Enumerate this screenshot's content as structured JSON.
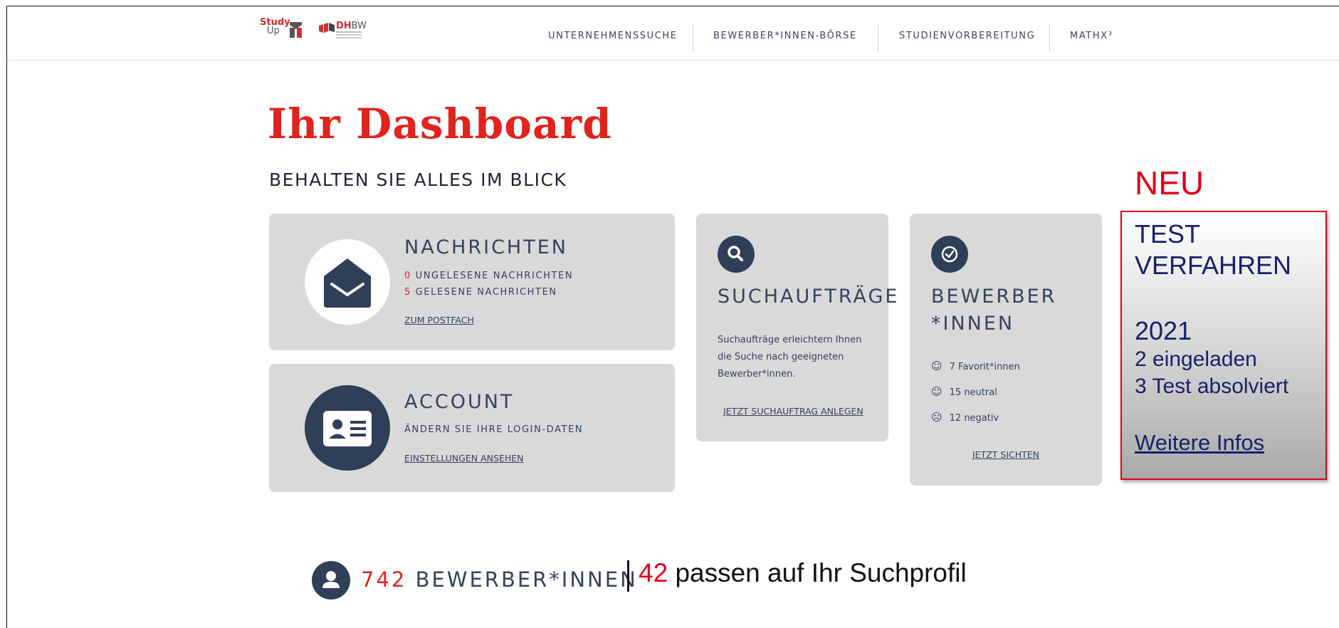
{
  "brand": {
    "study": "Study",
    "up": "Up",
    "dh": "DH",
    "bw": "BW"
  },
  "nav": [
    "UNTERNEHMENSSUCHE",
    "BEWERBER*INNEN-BÖRSE",
    "STUDIENVORBEREITUNG",
    "MATHX³"
  ],
  "page": {
    "title": "Ihr Dashboard",
    "subtitle": "BEHALTEN SIE ALLES IM BLICK"
  },
  "messages": {
    "heading": "NACHRICHTEN",
    "unread_count": "0",
    "unread_label": "UNGELESENE NACHRICHTEN",
    "read_count": "5",
    "read_label": "GELESENE NACHRICHTEN",
    "link": "ZUM POSTFACH"
  },
  "account": {
    "heading": "ACCOUNT",
    "text": "ÄNDERN SIE IHRE LOGIN-DATEN",
    "link": "EINSTELLUNGEN ANSEHEN"
  },
  "search": {
    "heading": "SUCHAUFTRÄGE",
    "line1": "Suchaufträge erleichtern Ihnen",
    "line2": "die Suche nach geeigneten",
    "line3": "Bewerber*innen.",
    "link": "JETZT SUCHAUFTRAG ANLEGEN"
  },
  "applicants": {
    "heading_1": "BEWERBER",
    "heading_2": "*INNEN",
    "favorites": "7 Favorit*innen",
    "neutral": "15 neutral",
    "negative": "12 negativ",
    "link": "JETZT SICHTEN"
  },
  "neu": {
    "label": "NEU",
    "line1": "TEST",
    "line2": "VERFAHREN",
    "year": "2021",
    "invited": "2 eingeladen",
    "completed": "3 Test absolviert",
    "link": "Weitere Infos"
  },
  "bottom": {
    "count": "742",
    "label": "BEWERBER*INNEN",
    "match_count": "42",
    "match_text": "passen auf Ihr Suchprofil"
  },
  "colors": {
    "brand_red": "#e0231d",
    "navy": "#2f3f57",
    "card_grey": "#d9d9d9",
    "neu_red": "#e0001b",
    "neu_text": "#17216a"
  }
}
